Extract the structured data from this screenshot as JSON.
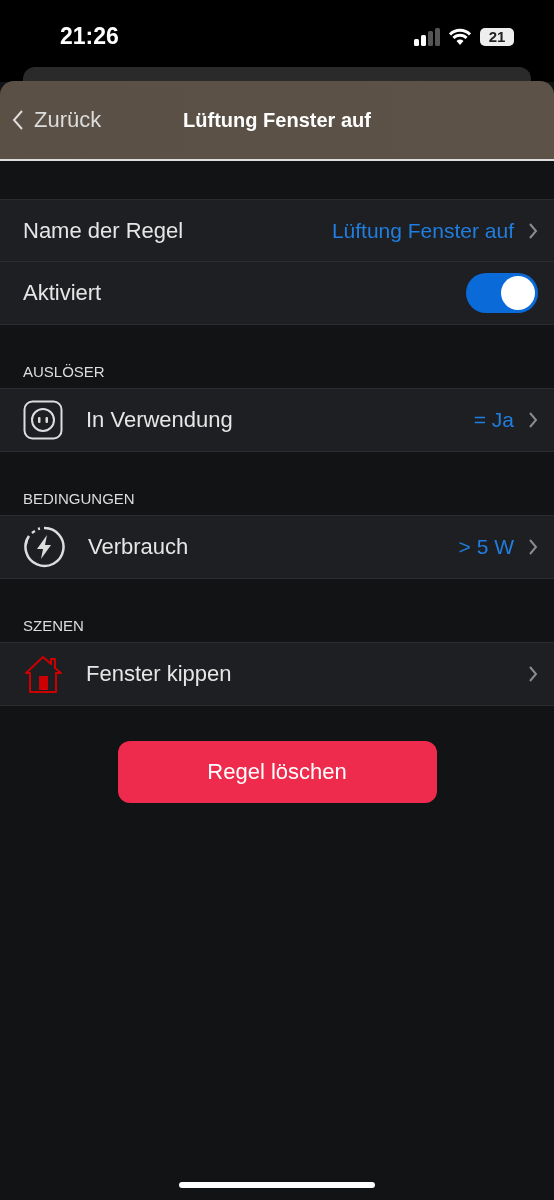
{
  "status_bar": {
    "time": "21:26",
    "battery": "21"
  },
  "nav": {
    "back": "Zurück",
    "title": "Lüftung Fenster auf"
  },
  "general": [
    {
      "kind": "value",
      "label": "Name der Regel",
      "value": "Lüftung Fenster auf"
    },
    {
      "kind": "toggle",
      "label": "Aktiviert",
      "on": true
    }
  ],
  "sections": [
    {
      "kind": "trigger",
      "header": "AUSLÖSER",
      "rows": [
        {
          "label": "In Verwendung",
          "value": "= Ja"
        }
      ]
    },
    {
      "kind": "condition",
      "header": "BEDINGUNGEN",
      "rows": [
        {
          "label": "Verbrauch",
          "value": "> 5 W"
        }
      ]
    },
    {
      "kind": "scene",
      "header": "SZENEN",
      "rows": [
        {
          "label": "Fenster kippen"
        }
      ]
    }
  ],
  "delete_button": "Regel löschen"
}
